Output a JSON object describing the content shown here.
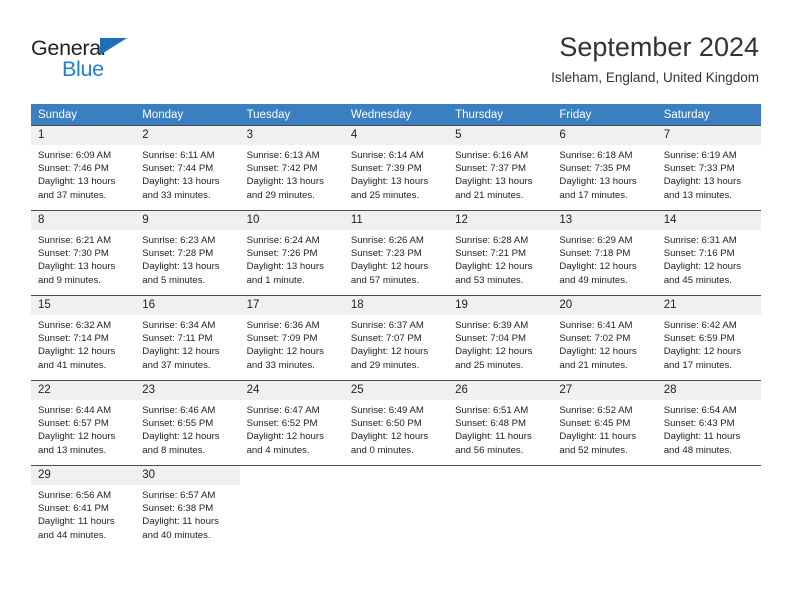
{
  "brand": {
    "name_top": "General",
    "name_bottom": "Blue",
    "triangle_color": "#1e6fb8",
    "blue_text_color": "#1f7fd4"
  },
  "header": {
    "title": "September 2024",
    "location": "Isleham, England, United Kingdom"
  },
  "theme": {
    "header_row_bg": "#3a7fc1",
    "header_row_text": "#ffffff",
    "daynum_bg": "#f0f0f0",
    "cell_border": "#4c4c4c",
    "body_text": "#222222"
  },
  "weekdays": [
    "Sunday",
    "Monday",
    "Tuesday",
    "Wednesday",
    "Thursday",
    "Friday",
    "Saturday"
  ],
  "weeks": [
    [
      {
        "day": "1",
        "sunrise": "Sunrise: 6:09 AM",
        "sunset": "Sunset: 7:46 PM",
        "daylight": "Daylight: 13 hours and 37 minutes."
      },
      {
        "day": "2",
        "sunrise": "Sunrise: 6:11 AM",
        "sunset": "Sunset: 7:44 PM",
        "daylight": "Daylight: 13 hours and 33 minutes."
      },
      {
        "day": "3",
        "sunrise": "Sunrise: 6:13 AM",
        "sunset": "Sunset: 7:42 PM",
        "daylight": "Daylight: 13 hours and 29 minutes."
      },
      {
        "day": "4",
        "sunrise": "Sunrise: 6:14 AM",
        "sunset": "Sunset: 7:39 PM",
        "daylight": "Daylight: 13 hours and 25 minutes."
      },
      {
        "day": "5",
        "sunrise": "Sunrise: 6:16 AM",
        "sunset": "Sunset: 7:37 PM",
        "daylight": "Daylight: 13 hours and 21 minutes."
      },
      {
        "day": "6",
        "sunrise": "Sunrise: 6:18 AM",
        "sunset": "Sunset: 7:35 PM",
        "daylight": "Daylight: 13 hours and 17 minutes."
      },
      {
        "day": "7",
        "sunrise": "Sunrise: 6:19 AM",
        "sunset": "Sunset: 7:33 PM",
        "daylight": "Daylight: 13 hours and 13 minutes."
      }
    ],
    [
      {
        "day": "8",
        "sunrise": "Sunrise: 6:21 AM",
        "sunset": "Sunset: 7:30 PM",
        "daylight": "Daylight: 13 hours and 9 minutes."
      },
      {
        "day": "9",
        "sunrise": "Sunrise: 6:23 AM",
        "sunset": "Sunset: 7:28 PM",
        "daylight": "Daylight: 13 hours and 5 minutes."
      },
      {
        "day": "10",
        "sunrise": "Sunrise: 6:24 AM",
        "sunset": "Sunset: 7:26 PM",
        "daylight": "Daylight: 13 hours and 1 minute."
      },
      {
        "day": "11",
        "sunrise": "Sunrise: 6:26 AM",
        "sunset": "Sunset: 7:23 PM",
        "daylight": "Daylight: 12 hours and 57 minutes."
      },
      {
        "day": "12",
        "sunrise": "Sunrise: 6:28 AM",
        "sunset": "Sunset: 7:21 PM",
        "daylight": "Daylight: 12 hours and 53 minutes."
      },
      {
        "day": "13",
        "sunrise": "Sunrise: 6:29 AM",
        "sunset": "Sunset: 7:18 PM",
        "daylight": "Daylight: 12 hours and 49 minutes."
      },
      {
        "day": "14",
        "sunrise": "Sunrise: 6:31 AM",
        "sunset": "Sunset: 7:16 PM",
        "daylight": "Daylight: 12 hours and 45 minutes."
      }
    ],
    [
      {
        "day": "15",
        "sunrise": "Sunrise: 6:32 AM",
        "sunset": "Sunset: 7:14 PM",
        "daylight": "Daylight: 12 hours and 41 minutes."
      },
      {
        "day": "16",
        "sunrise": "Sunrise: 6:34 AM",
        "sunset": "Sunset: 7:11 PM",
        "daylight": "Daylight: 12 hours and 37 minutes."
      },
      {
        "day": "17",
        "sunrise": "Sunrise: 6:36 AM",
        "sunset": "Sunset: 7:09 PM",
        "daylight": "Daylight: 12 hours and 33 minutes."
      },
      {
        "day": "18",
        "sunrise": "Sunrise: 6:37 AM",
        "sunset": "Sunset: 7:07 PM",
        "daylight": "Daylight: 12 hours and 29 minutes."
      },
      {
        "day": "19",
        "sunrise": "Sunrise: 6:39 AM",
        "sunset": "Sunset: 7:04 PM",
        "daylight": "Daylight: 12 hours and 25 minutes."
      },
      {
        "day": "20",
        "sunrise": "Sunrise: 6:41 AM",
        "sunset": "Sunset: 7:02 PM",
        "daylight": "Daylight: 12 hours and 21 minutes."
      },
      {
        "day": "21",
        "sunrise": "Sunrise: 6:42 AM",
        "sunset": "Sunset: 6:59 PM",
        "daylight": "Daylight: 12 hours and 17 minutes."
      }
    ],
    [
      {
        "day": "22",
        "sunrise": "Sunrise: 6:44 AM",
        "sunset": "Sunset: 6:57 PM",
        "daylight": "Daylight: 12 hours and 13 minutes."
      },
      {
        "day": "23",
        "sunrise": "Sunrise: 6:46 AM",
        "sunset": "Sunset: 6:55 PM",
        "daylight": "Daylight: 12 hours and 8 minutes."
      },
      {
        "day": "24",
        "sunrise": "Sunrise: 6:47 AM",
        "sunset": "Sunset: 6:52 PM",
        "daylight": "Daylight: 12 hours and 4 minutes."
      },
      {
        "day": "25",
        "sunrise": "Sunrise: 6:49 AM",
        "sunset": "Sunset: 6:50 PM",
        "daylight": "Daylight: 12 hours and 0 minutes."
      },
      {
        "day": "26",
        "sunrise": "Sunrise: 6:51 AM",
        "sunset": "Sunset: 6:48 PM",
        "daylight": "Daylight: 11 hours and 56 minutes."
      },
      {
        "day": "27",
        "sunrise": "Sunrise: 6:52 AM",
        "sunset": "Sunset: 6:45 PM",
        "daylight": "Daylight: 11 hours and 52 minutes."
      },
      {
        "day": "28",
        "sunrise": "Sunrise: 6:54 AM",
        "sunset": "Sunset: 6:43 PM",
        "daylight": "Daylight: 11 hours and 48 minutes."
      }
    ],
    [
      {
        "day": "29",
        "sunrise": "Sunrise: 6:56 AM",
        "sunset": "Sunset: 6:41 PM",
        "daylight": "Daylight: 11 hours and 44 minutes."
      },
      {
        "day": "30",
        "sunrise": "Sunrise: 6:57 AM",
        "sunset": "Sunset: 6:38 PM",
        "daylight": "Daylight: 11 hours and 40 minutes."
      },
      {
        "day": "",
        "sunrise": "",
        "sunset": "",
        "daylight": ""
      },
      {
        "day": "",
        "sunrise": "",
        "sunset": "",
        "daylight": ""
      },
      {
        "day": "",
        "sunrise": "",
        "sunset": "",
        "daylight": ""
      },
      {
        "day": "",
        "sunrise": "",
        "sunset": "",
        "daylight": ""
      },
      {
        "day": "",
        "sunrise": "",
        "sunset": "",
        "daylight": ""
      }
    ]
  ]
}
